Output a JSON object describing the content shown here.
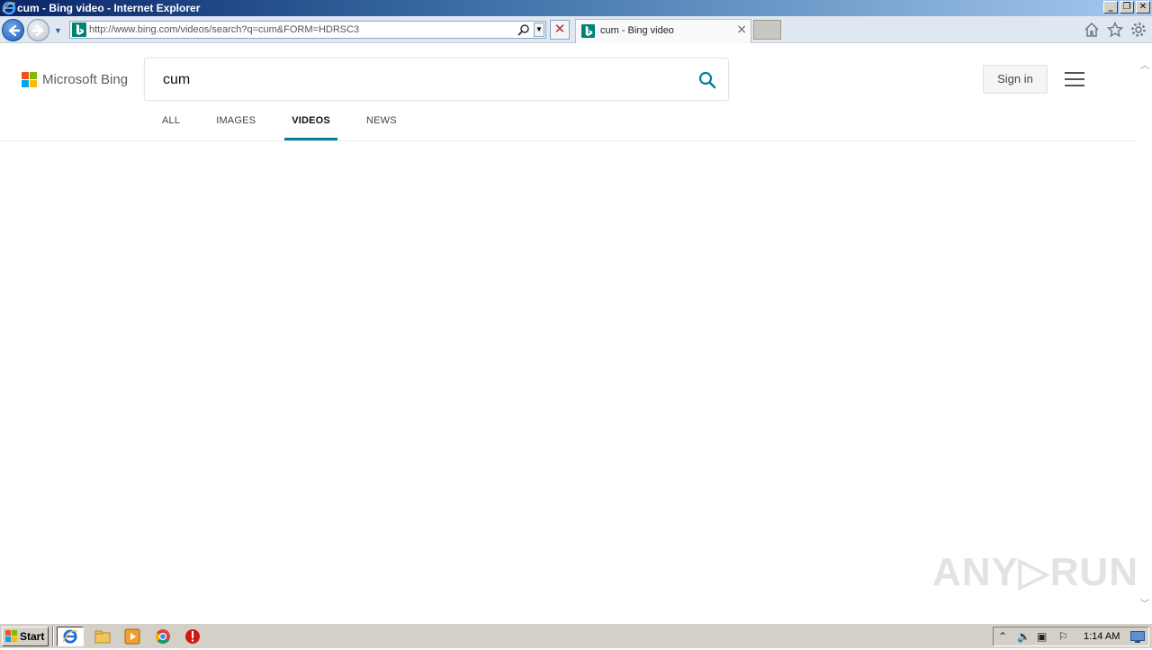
{
  "window": {
    "title": "cum - Bing video - Internet Explorer",
    "controls": [
      "_",
      "❐",
      "✕"
    ]
  },
  "browser": {
    "url": "http://www.bing.com/videos/search?q=cum&FORM=HDRSC3",
    "stop_symbol": "✕",
    "tab_title": "cum - Bing video",
    "tab_close": "×",
    "address_dropdown": "▼"
  },
  "bing": {
    "brand": "Microsoft Bing",
    "query": "cum",
    "sign_in": "Sign in",
    "scopes": [
      {
        "label": "ALL",
        "active": false
      },
      {
        "label": "IMAGES",
        "active": false
      },
      {
        "label": "VIDEOS",
        "active": true
      },
      {
        "label": "NEWS",
        "active": false
      }
    ],
    "accent_color": "#00809d"
  },
  "watermark": "ANY▷RUN",
  "taskbar": {
    "start_label": "Start",
    "clock": "1:14 AM"
  },
  "colors": {
    "titlebar_start": "#0a246a",
    "bing_teal": "#008373",
    "taskbar_bg": "#d4d0c8"
  }
}
